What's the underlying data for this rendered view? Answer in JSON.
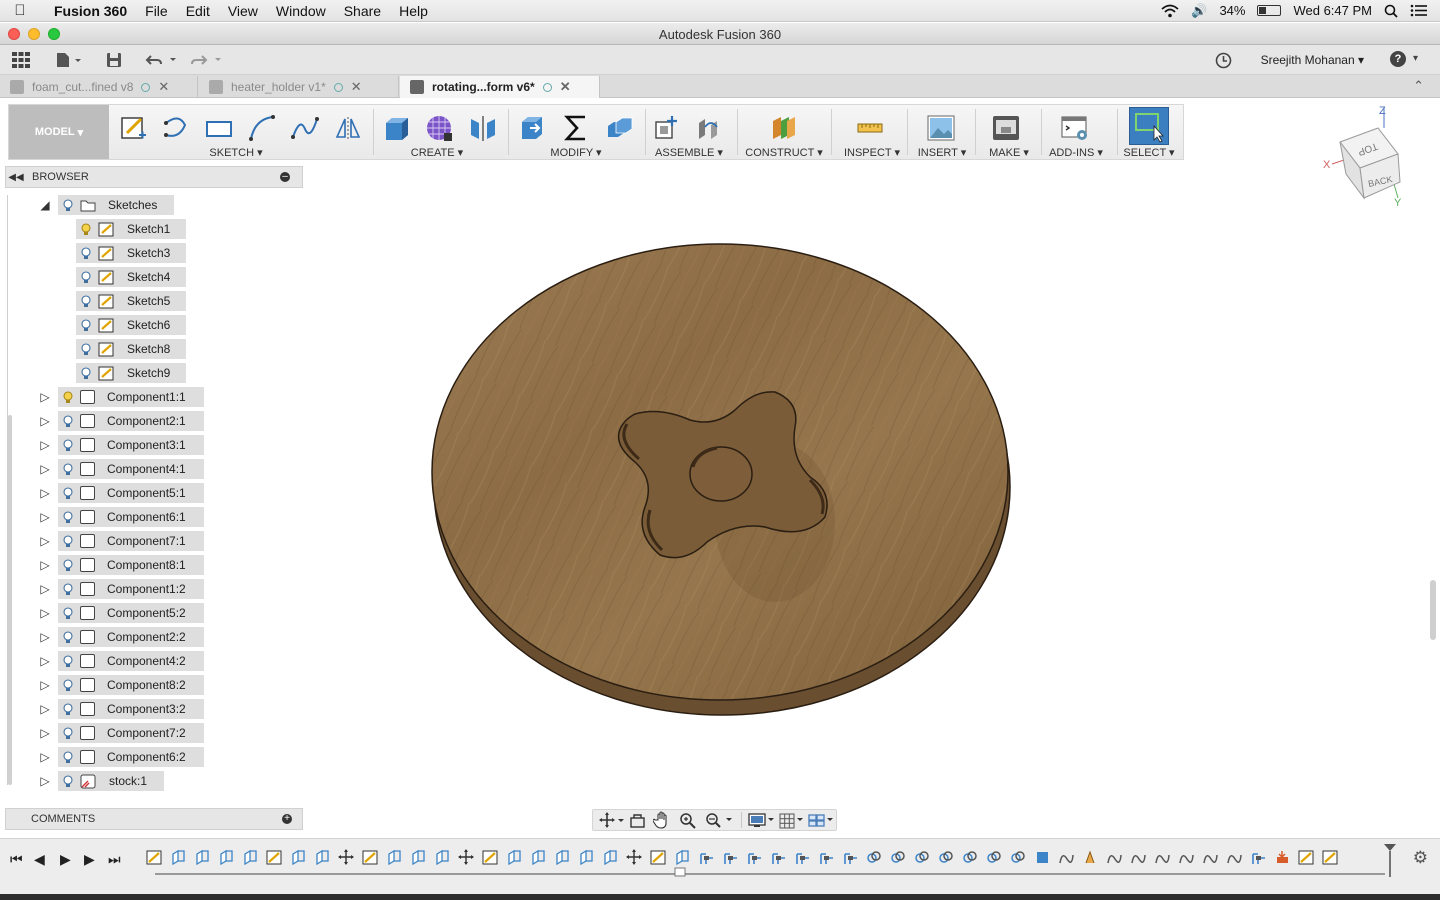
{
  "menubar": {
    "app_name": "Fusion 360",
    "items": [
      "File",
      "Edit",
      "View",
      "Window",
      "Share",
      "Help"
    ],
    "battery": "34%",
    "clock": "Wed 6:47 PM"
  },
  "window": {
    "title": "Autodesk Fusion 360"
  },
  "apptoolbar": {
    "user": "Sreejith Mohanan",
    "help": "?"
  },
  "tabs": [
    {
      "label": "foam_cut...fined v8",
      "active": false
    },
    {
      "label": "heater_holder v1*",
      "active": false
    },
    {
      "label": "rotating...form v6*",
      "active": true
    }
  ],
  "ribbon": {
    "workspace": "MODEL",
    "groups": [
      "SKETCH",
      "CREATE",
      "MODIFY",
      "ASSEMBLE",
      "CONSTRUCT",
      "INSPECT",
      "INSERT",
      "MAKE",
      "ADD-INS",
      "SELECT"
    ]
  },
  "browser": {
    "title": "BROWSER",
    "sketches_folder": "Sketches",
    "sketches": [
      "Sketch1",
      "Sketch3",
      "Sketch4",
      "Sketch5",
      "Sketch6",
      "Sketch8",
      "Sketch9"
    ],
    "components": [
      "Component1:1",
      "Component2:1",
      "Component3:1",
      "Component4:1",
      "Component5:1",
      "Component6:1",
      "Component7:1",
      "Component8:1",
      "Component1:2",
      "Component5:2",
      "Component2:2",
      "Component4:2",
      "Component8:2",
      "Component3:2",
      "Component7:2",
      "Component6:2"
    ],
    "stock": "stock:1"
  },
  "viewcube": {
    "face_top": "TOP",
    "face_back": "BACK",
    "axis_x": "X",
    "axis_y": "Y",
    "axis_z": "Z"
  },
  "comments": {
    "title": "COMMENTS"
  },
  "colors": {
    "accent_blue": "#2f6fb3",
    "select_blue": "#3c7fc1",
    "wood": "#8a6b45",
    "active_bulb": "#e8c33a"
  }
}
